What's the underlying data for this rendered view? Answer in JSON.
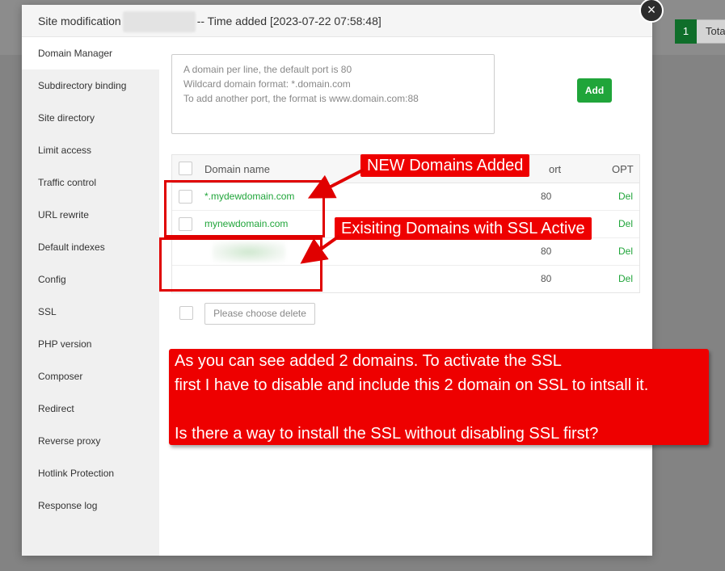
{
  "background": {
    "page_number": "1",
    "total_label": "Tota"
  },
  "dialog": {
    "title_prefix": "Site modification",
    "title_suffix": "-- Time added [2023-07-22 07:58:48]",
    "close_symbol": "×"
  },
  "sidebar": {
    "items": [
      {
        "label": "Domain Manager"
      },
      {
        "label": "Subdirectory binding"
      },
      {
        "label": "Site directory"
      },
      {
        "label": "Limit access"
      },
      {
        "label": "Traffic control"
      },
      {
        "label": "URL rewrite"
      },
      {
        "label": "Default indexes"
      },
      {
        "label": "Config"
      },
      {
        "label": "SSL"
      },
      {
        "label": "PHP version"
      },
      {
        "label": "Composer"
      },
      {
        "label": "Redirect"
      },
      {
        "label": "Reverse proxy"
      },
      {
        "label": "Hotlink Protection"
      },
      {
        "label": "Response log"
      }
    ]
  },
  "domain_input": {
    "placeholder": "A domain per line, the default port is 80\nWildcard domain format: *.domain.com\nTo add another port, the format is www.domain.com:88",
    "add_label": "Add"
  },
  "table": {
    "headers": {
      "domain": "Domain name",
      "port": "ort",
      "opt": "OPT"
    },
    "rows": [
      {
        "domain": "*.mydewdomain.com",
        "port": "80",
        "action": "Del"
      },
      {
        "domain": "mynewdomain.com",
        "port": "",
        "action": "Del"
      },
      {
        "domain": "",
        "port": "80",
        "action": "Del"
      },
      {
        "domain": "",
        "port": "80",
        "action": "Del"
      }
    ]
  },
  "batch": {
    "delete_placeholder": "Please choose delete"
  },
  "annotations": {
    "new_domains": "NEW Domains Added",
    "existing_domains": "Exisiting Domains with SSL Active",
    "note": "As you can see added 2 domains. To activate the SSL\nfirst I have to disable and include this 2 domain on SSL to intsall it.\n\nIs there a way to install the SSL without disabling SSL first?"
  },
  "colors": {
    "accent_green": "#20a53a",
    "annotation_red": "#ee0000"
  }
}
